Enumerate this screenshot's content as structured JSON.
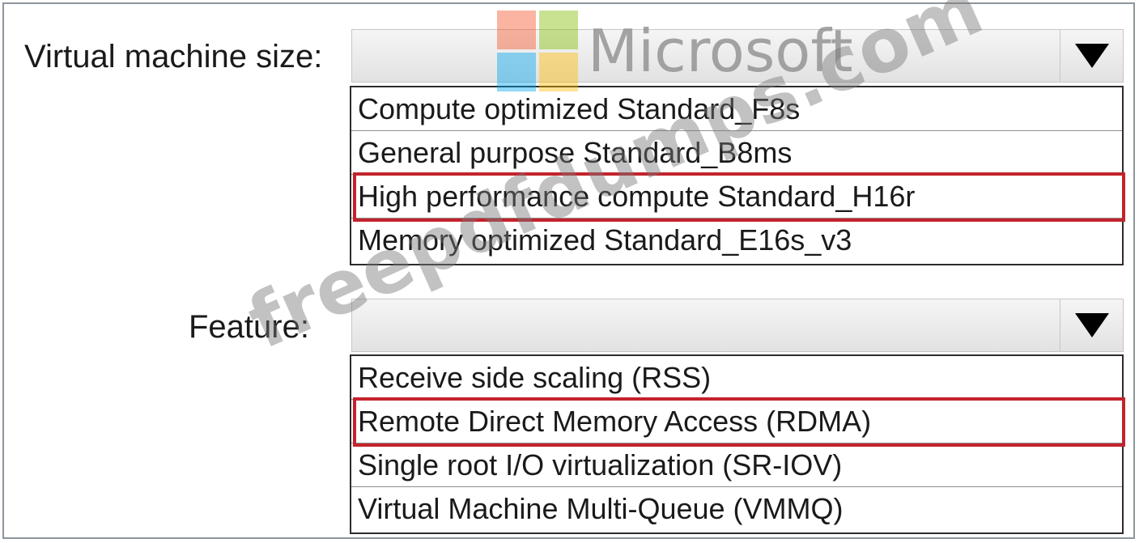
{
  "colors": {
    "highlight": "#c3232c",
    "logo_red": "#f25022",
    "logo_green": "#7fba00",
    "logo_blue": "#00a4ef",
    "logo_yellow": "#ffb900"
  },
  "logo": {
    "text": "Microsoft",
    "icon": "microsoft-logo-icon"
  },
  "watermark": {
    "text": "freepdfdumps.com"
  },
  "vm_size": {
    "label": "Virtual machine size:",
    "selected_value": "",
    "options": [
      {
        "label": "Compute optimized Standard_F8s",
        "highlighted": false
      },
      {
        "label": "General purpose Standard_B8ms",
        "highlighted": false
      },
      {
        "label": "High performance compute Standard_H16r",
        "highlighted": true
      },
      {
        "label": "Memory optimized Standard_E16s_v3",
        "highlighted": false
      }
    ]
  },
  "feature": {
    "label": "Feature:",
    "selected_value": "",
    "options": [
      {
        "label": "Receive side scaling (RSS)",
        "highlighted": false
      },
      {
        "label": "Remote Direct Memory Access (RDMA)",
        "highlighted": true
      },
      {
        "label": "Single root I/O virtualization (SR-IOV)",
        "highlighted": false
      },
      {
        "label": "Virtual Machine Multi-Queue (VMMQ)",
        "highlighted": false
      }
    ]
  }
}
